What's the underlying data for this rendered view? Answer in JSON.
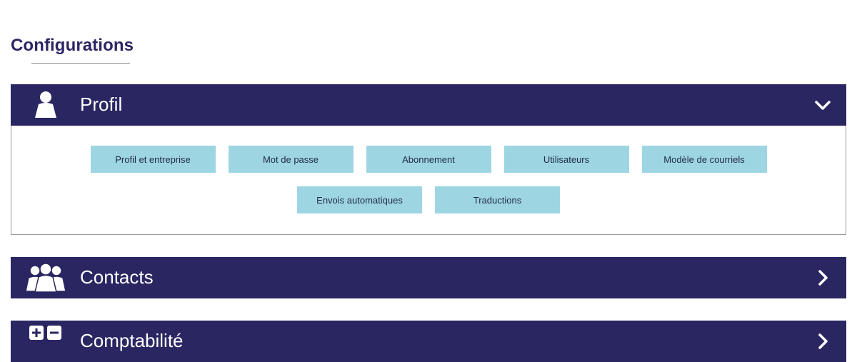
{
  "page": {
    "title": "Configurations"
  },
  "sections": [
    {
      "title": "Profil",
      "icon": "user-icon",
      "toggle_icon": "chevron-down-icon",
      "expanded": true,
      "buttons": [
        "Profil et entreprise",
        "Mot de passe",
        "Abonnement",
        "Utilisateurs",
        "Modèle de courriels",
        "Envois automatiques",
        "Traductions"
      ]
    },
    {
      "title": "Contacts",
      "icon": "users-group-icon",
      "toggle_icon": "chevron-right-icon",
      "expanded": false
    },
    {
      "title": "Comptabilité",
      "icon": "plus-minus-icon",
      "toggle_icon": "chevron-right-icon",
      "expanded": false
    }
  ],
  "colors": {
    "header_bg": "#2a2662",
    "title_text": "#2b2563",
    "button_bg": "#9dd5e3",
    "button_text": "#1f2a44"
  }
}
